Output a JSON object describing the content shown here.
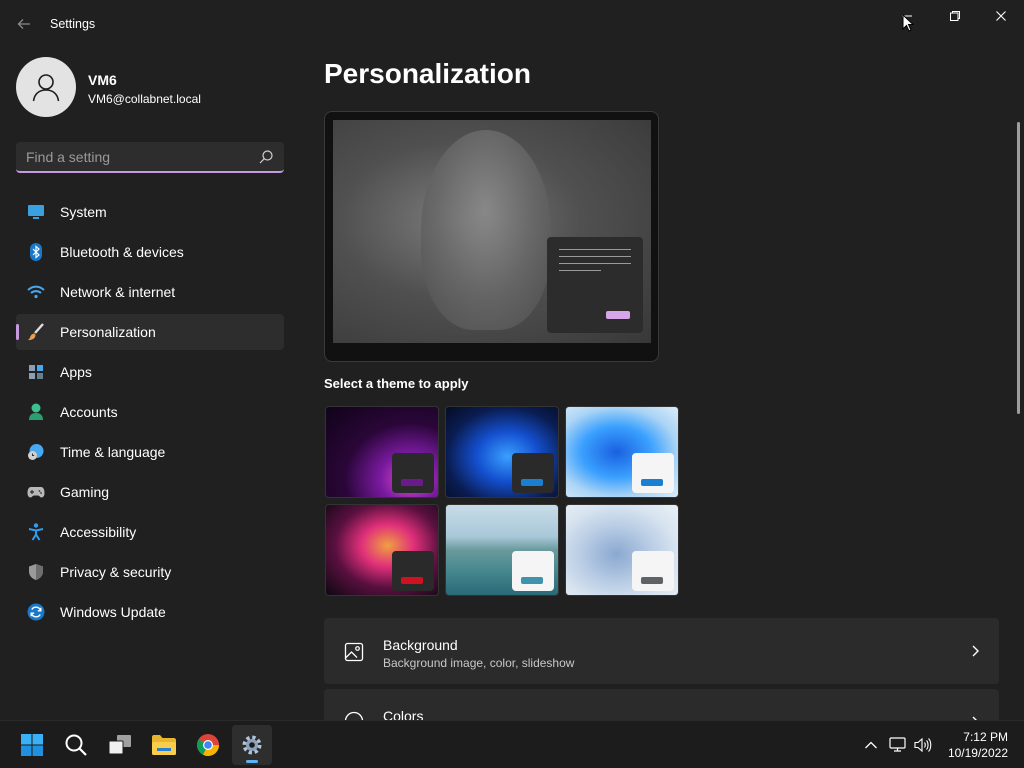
{
  "window": {
    "title": "Settings"
  },
  "profile": {
    "name": "VM6",
    "email": "VM6@collabnet.local"
  },
  "search": {
    "placeholder": "Find a setting"
  },
  "sidebar": {
    "items": [
      {
        "label": "System",
        "icon": "monitor-icon",
        "active": false
      },
      {
        "label": "Bluetooth & devices",
        "icon": "bluetooth-icon",
        "active": false
      },
      {
        "label": "Network & internet",
        "icon": "wifi-icon",
        "active": false
      },
      {
        "label": "Personalization",
        "icon": "paintbrush-icon",
        "active": true
      },
      {
        "label": "Apps",
        "icon": "apps-icon",
        "active": false
      },
      {
        "label": "Accounts",
        "icon": "person-icon",
        "active": false
      },
      {
        "label": "Time & language",
        "icon": "clock-globe-icon",
        "active": false
      },
      {
        "label": "Gaming",
        "icon": "gamepad-icon",
        "active": false
      },
      {
        "label": "Accessibility",
        "icon": "accessibility-icon",
        "active": false
      },
      {
        "label": "Privacy & security",
        "icon": "shield-icon",
        "active": false
      },
      {
        "label": "Windows Update",
        "icon": "update-icon",
        "active": false
      }
    ]
  },
  "main": {
    "title": "Personalization",
    "themes_heading": "Select a theme to apply",
    "themes": [
      {
        "name": "glow-dark",
        "accent": "#6b1a8c"
      },
      {
        "name": "bloom-dark",
        "accent": "#1a7fd1"
      },
      {
        "name": "bloom-light",
        "accent": "#1a7fd1"
      },
      {
        "name": "captured-motion",
        "accent": "#d0121f"
      },
      {
        "name": "sunrise-lake",
        "accent": "#3f93ad"
      },
      {
        "name": "flow-light",
        "accent": "#5f6366"
      }
    ],
    "cards": [
      {
        "title": "Background",
        "subtitle": "Background image, color, slideshow",
        "icon": "image-icon"
      },
      {
        "title": "Colors",
        "subtitle": "",
        "icon": "palette-icon"
      }
    ]
  },
  "taskbar": {
    "apps": [
      "start-icon",
      "search-icon",
      "task-view-icon",
      "file-explorer-icon",
      "chrome-icon",
      "settings-icon"
    ],
    "time": "7:12 PM",
    "date": "10/19/2022"
  },
  "colors": {
    "accent": "#c79ae0",
    "background": "#202020",
    "card": "#2b2b2b"
  }
}
